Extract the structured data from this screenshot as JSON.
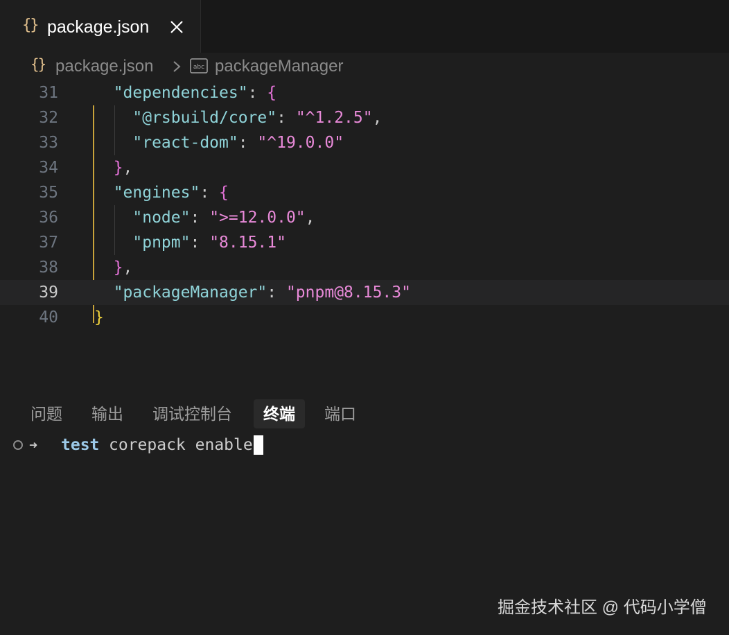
{
  "tab": {
    "icon_text": "{}",
    "label": "package.json",
    "close_symbol": "×"
  },
  "breadcrumb": {
    "file_icon_text": "{}",
    "file": "package.json",
    "symbol_icon_text": "abc",
    "symbol": "packageManager"
  },
  "editor": {
    "lines": [
      {
        "number": "31",
        "indent": "  ",
        "key": "\"dependencies\"",
        "sep": ": ",
        "value": "",
        "open": "{",
        "close": "",
        "trail": ""
      },
      {
        "number": "32",
        "indent": "    ",
        "key": "\"@rsbuild/core\"",
        "sep": ": ",
        "value": "\"^1.2.5\"",
        "open": "",
        "close": "",
        "trail": ","
      },
      {
        "number": "33",
        "indent": "    ",
        "key": "\"react-dom\"",
        "sep": ": ",
        "value": "\"^19.0.0\"",
        "open": "",
        "close": "",
        "trail": ""
      },
      {
        "number": "34",
        "indent": "  ",
        "key": "",
        "sep": "",
        "value": "",
        "open": "",
        "close": "}",
        "trail": ","
      },
      {
        "number": "35",
        "indent": "  ",
        "key": "\"engines\"",
        "sep": ": ",
        "value": "",
        "open": "{",
        "close": "",
        "trail": ""
      },
      {
        "number": "36",
        "indent": "    ",
        "key": "\"node\"",
        "sep": ": ",
        "value": "\">=12.0.0\"",
        "open": "",
        "close": "",
        "trail": ","
      },
      {
        "number": "37",
        "indent": "    ",
        "key": "\"pnpm\"",
        "sep": ": ",
        "value": "\"8.15.1\"",
        "open": "",
        "close": "",
        "trail": ""
      },
      {
        "number": "38",
        "indent": "  ",
        "key": "",
        "sep": "",
        "value": "",
        "open": "",
        "close": "}",
        "trail": ","
      },
      {
        "number": "39",
        "indent": "  ",
        "key": "\"packageManager\"",
        "sep": ": ",
        "value": "\"pnpm@8.15.3\"",
        "open": "",
        "close": "",
        "trail": ""
      },
      {
        "number": "40",
        "indent": "",
        "key": "",
        "sep": "",
        "value": "",
        "open": "",
        "close": "}",
        "trail": ""
      }
    ],
    "active_line": "39"
  },
  "panel": {
    "tabs": [
      "问题",
      "输出",
      "调试控制台",
      "终端",
      "端口"
    ],
    "active_tab": "终端"
  },
  "terminal": {
    "arrow": "➜",
    "directory": "test",
    "command": "corepack enable"
  },
  "watermark": "掘金技术社区 @ 代码小学僧",
  "colors": {
    "background": "#1e1e1e",
    "key": "#8fd3d8",
    "string": "#e98ad9",
    "bracket_pink": "#e372d7",
    "bracket_yellow": "#f2d43c",
    "json_icon": "#e2c08d"
  }
}
